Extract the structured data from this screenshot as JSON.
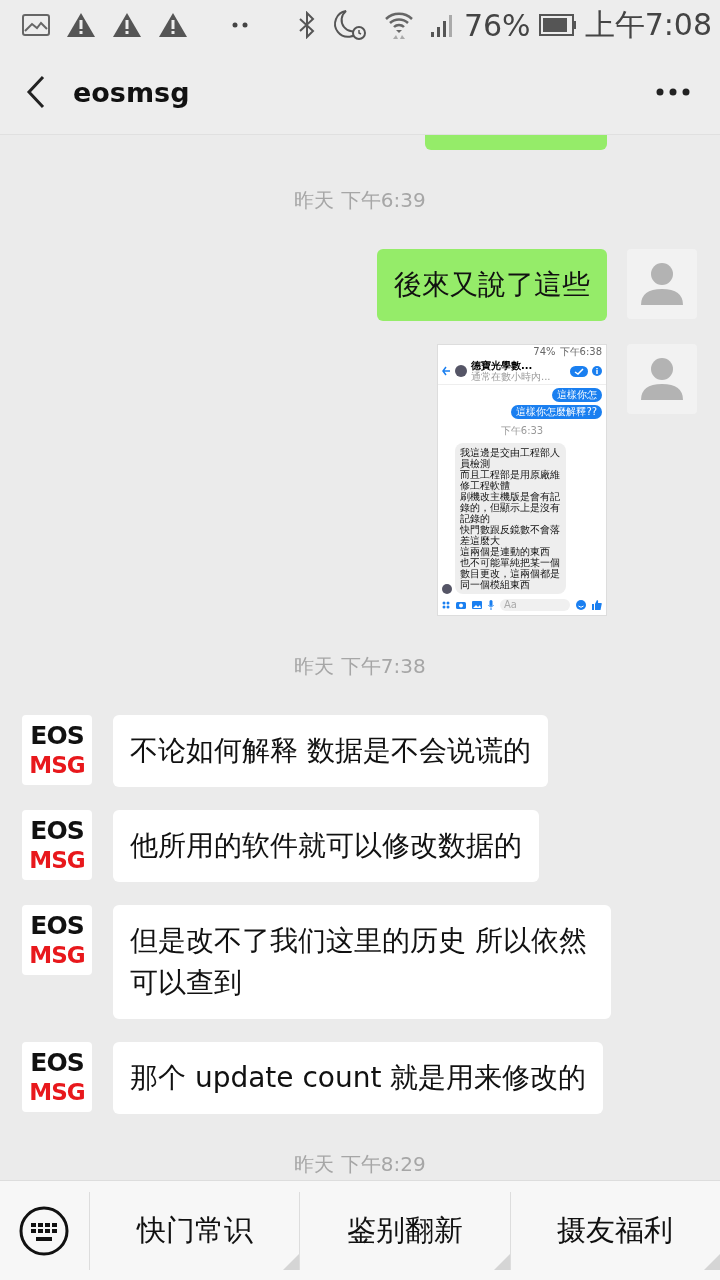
{
  "status_bar": {
    "battery_text": "76%",
    "time": "上午7:08"
  },
  "header": {
    "title": "eosmsg"
  },
  "messages": [
    {
      "kind": "sent_partial"
    },
    {
      "kind": "time",
      "text": "昨天 下午6:39"
    },
    {
      "kind": "sent_text",
      "text": "後來又說了這些"
    },
    {
      "kind": "sent_image",
      "screenshot": {
        "battery_text": "74%",
        "time": "下午6:38",
        "title": "德寶光學數...",
        "subtitle": "通常在數小時內...",
        "sent": [
          "這樣你怎",
          "這樣你怎麼解釋??"
        ],
        "timestamp": "下午6:33",
        "reply_lines": [
          "我這邊是交由工程部人員檢測",
          "而且工程部是用原廠維修工程軟體",
          "刷機改主機版是會有記錄的，但顯示上是沒有記錄的",
          "快門數跟反鏡數不會落差這麼大",
          "這兩個是連動的東西",
          "也不可能單純把某一個數目更改，這兩個都是同一個模組東西"
        ],
        "placeholder": "Aa"
      }
    },
    {
      "kind": "time",
      "text": "昨天 下午7:38"
    },
    {
      "kind": "received_text",
      "avatar": {
        "top": "EOS",
        "bottom": "MSG"
      },
      "text": "不论如何解释 数据是不会说谎的"
    },
    {
      "kind": "received_text",
      "avatar": {
        "top": "EOS",
        "bottom": "MSG"
      },
      "text": "他所用的软件就可以修改数据的"
    },
    {
      "kind": "received_text",
      "avatar": {
        "top": "EOS",
        "bottom": "MSG"
      },
      "text": "但是改不了我们这里的历史 所以依然可以查到"
    },
    {
      "kind": "received_text",
      "avatar": {
        "top": "EOS",
        "bottom": "MSG"
      },
      "text": "那个 update count 就是用来修改的"
    },
    {
      "kind": "time",
      "text": "昨天 下午8:29"
    }
  ],
  "bottom_menu": [
    {
      "label": "快门常识"
    },
    {
      "label": "鉴别翻新"
    },
    {
      "label": "摄友福利"
    }
  ]
}
